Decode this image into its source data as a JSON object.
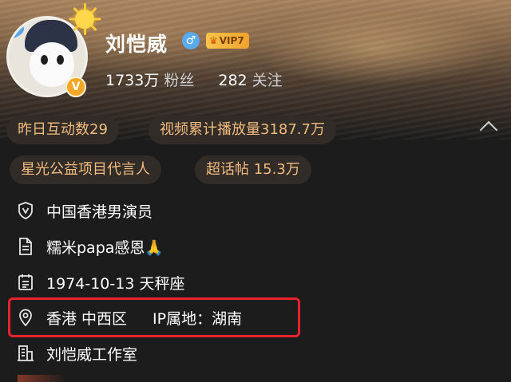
{
  "profile": {
    "name": "刘恺威",
    "gender_symbol": "♂",
    "vip_label": "VIP7",
    "verified_badge": "V"
  },
  "stats": {
    "followers_value": "1733万",
    "followers_label": "粉丝",
    "following_value": "282",
    "following_label": "关注"
  },
  "pills": {
    "interactions": "昨日互动数29",
    "video_plays": "视频累计播放量3187.7万",
    "charity": "星光公益项目代言人",
    "super_topic": "超话帖 15.3万"
  },
  "info": {
    "occupation": "中国香港男演员",
    "bio": "糯米papa感恩🙏",
    "birthday": "1974-10-13 天秤座",
    "location": "香港 中西区",
    "ip_location": "IP属地：湖南",
    "studio": "刘恺威工作室"
  },
  "icons": {
    "occupation": "shield-v-icon",
    "bio": "document-icon",
    "birthday": "calendar-icon",
    "location": "location-pin-icon",
    "studio": "building-icon",
    "collapse": "chevron-up-icon"
  },
  "colors": {
    "background": "#1c1c1c",
    "pill_bg": "#312c27",
    "pill_text": "#f2bb7d",
    "highlight": "#e8232c",
    "vip_gold": "#f6c44a",
    "gender_blue": "#5aaaf0"
  }
}
